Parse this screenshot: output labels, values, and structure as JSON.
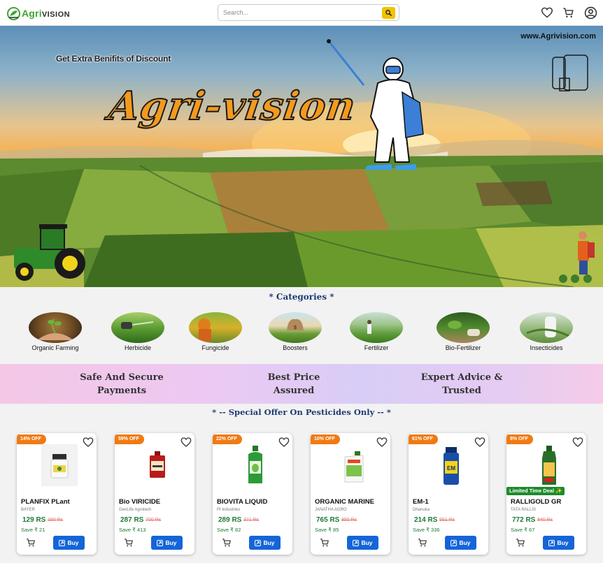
{
  "header": {
    "logo_agri": "Agri",
    "logo_vision": "VISION",
    "search_placeholder": "Search...",
    "icons": [
      "search-icon",
      "heart-icon",
      "cart-icon",
      "user-icon"
    ]
  },
  "hero": {
    "url": "www.Agrivision.com",
    "subtitle": "Get Extra Benifits of Discount",
    "title": "Agri-vision"
  },
  "categories": {
    "title": "* Categories *",
    "items": [
      {
        "label": "Organic Farming"
      },
      {
        "label": "Herbicide"
      },
      {
        "label": "Fungicide"
      },
      {
        "label": "Boosters"
      },
      {
        "label": "Fertilizer"
      },
      {
        "label": "Bio-Fertilizer"
      },
      {
        "label": "Insecticides"
      }
    ]
  },
  "banner": {
    "items": [
      {
        "line1": "Safe And Secure",
        "line2": "Payments"
      },
      {
        "line1": "Best Price",
        "line2": "Assured"
      },
      {
        "line1": "Expert Advice &",
        "line2": "Trusted"
      }
    ]
  },
  "offer": {
    "title": "* -- Special Offer On Pesticides Only -- *"
  },
  "products": [
    {
      "badge": "14% OFF",
      "name": "PLANFIX PLant",
      "brand": "BAYER",
      "price": "129 RS",
      "mrp": "150 Rs",
      "save": "Save ₹ 21",
      "buy": "Buy",
      "deal": ""
    },
    {
      "badge": "59% OFF",
      "name": "Bio VIRICIDE",
      "brand": "GeoLife Agrotech",
      "price": "287 RS",
      "mrp": "700 Rs",
      "save": "Save ₹ 413",
      "buy": "Buy",
      "deal": ""
    },
    {
      "badge": "22% OFF",
      "name": "BIOVITA LIQUID",
      "brand": "PI Industries",
      "price": "289 RS",
      "mrp": "371 Rs",
      "save": "Save ₹ 82",
      "buy": "Buy",
      "deal": ""
    },
    {
      "badge": "10% OFF",
      "name": "ORGANIC MARINE",
      "brand": "JANATHA AGRO",
      "price": "765 RS",
      "mrp": "850 Rs",
      "save": "Save ₹ 85",
      "buy": "Buy",
      "deal": ""
    },
    {
      "badge": "61% OFF",
      "name": "EM-1",
      "brand": "Dhanuka",
      "price": "214 RS",
      "mrp": "551 Rs",
      "save": "Save ₹ 336",
      "buy": "Buy",
      "deal": ""
    },
    {
      "badge": "8% OFF",
      "name": "RALLIGOLD GR",
      "brand": "TATA RALLIS",
      "price": "772 RS",
      "mrp": "840 Rs",
      "save": "Save ₹ 67",
      "buy": "Buy",
      "deal": "Limited Time Deal ✨"
    }
  ],
  "colors": {
    "accent_green": "#3fa535",
    "search_button": "#f2c300",
    "badge_orange": "#f07a12",
    "buy_blue": "#1565d8",
    "price_green": "#1d7a34",
    "heading_navy": "#1e3a73"
  }
}
